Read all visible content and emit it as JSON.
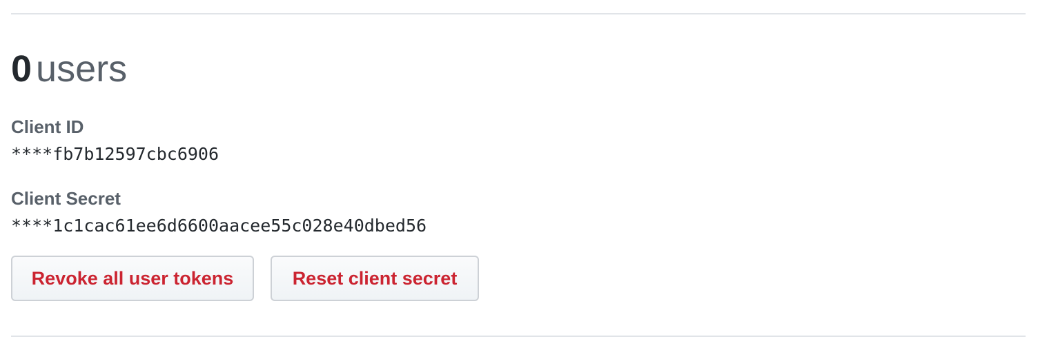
{
  "users_summary": {
    "count": "0",
    "label": "users"
  },
  "client_id": {
    "label": "Client ID",
    "value": "****fb7b12597cbc6906"
  },
  "client_secret": {
    "label": "Client Secret",
    "value": "****1c1cac61ee6d6600aacee55c028e40dbed56"
  },
  "actions": {
    "revoke_label": "Revoke all user tokens",
    "reset_label": "Reset client secret"
  },
  "colors": {
    "danger_text": "#cb2431",
    "muted_text": "#586069",
    "primary_text": "#24292e",
    "border": "#e1e4e8"
  }
}
